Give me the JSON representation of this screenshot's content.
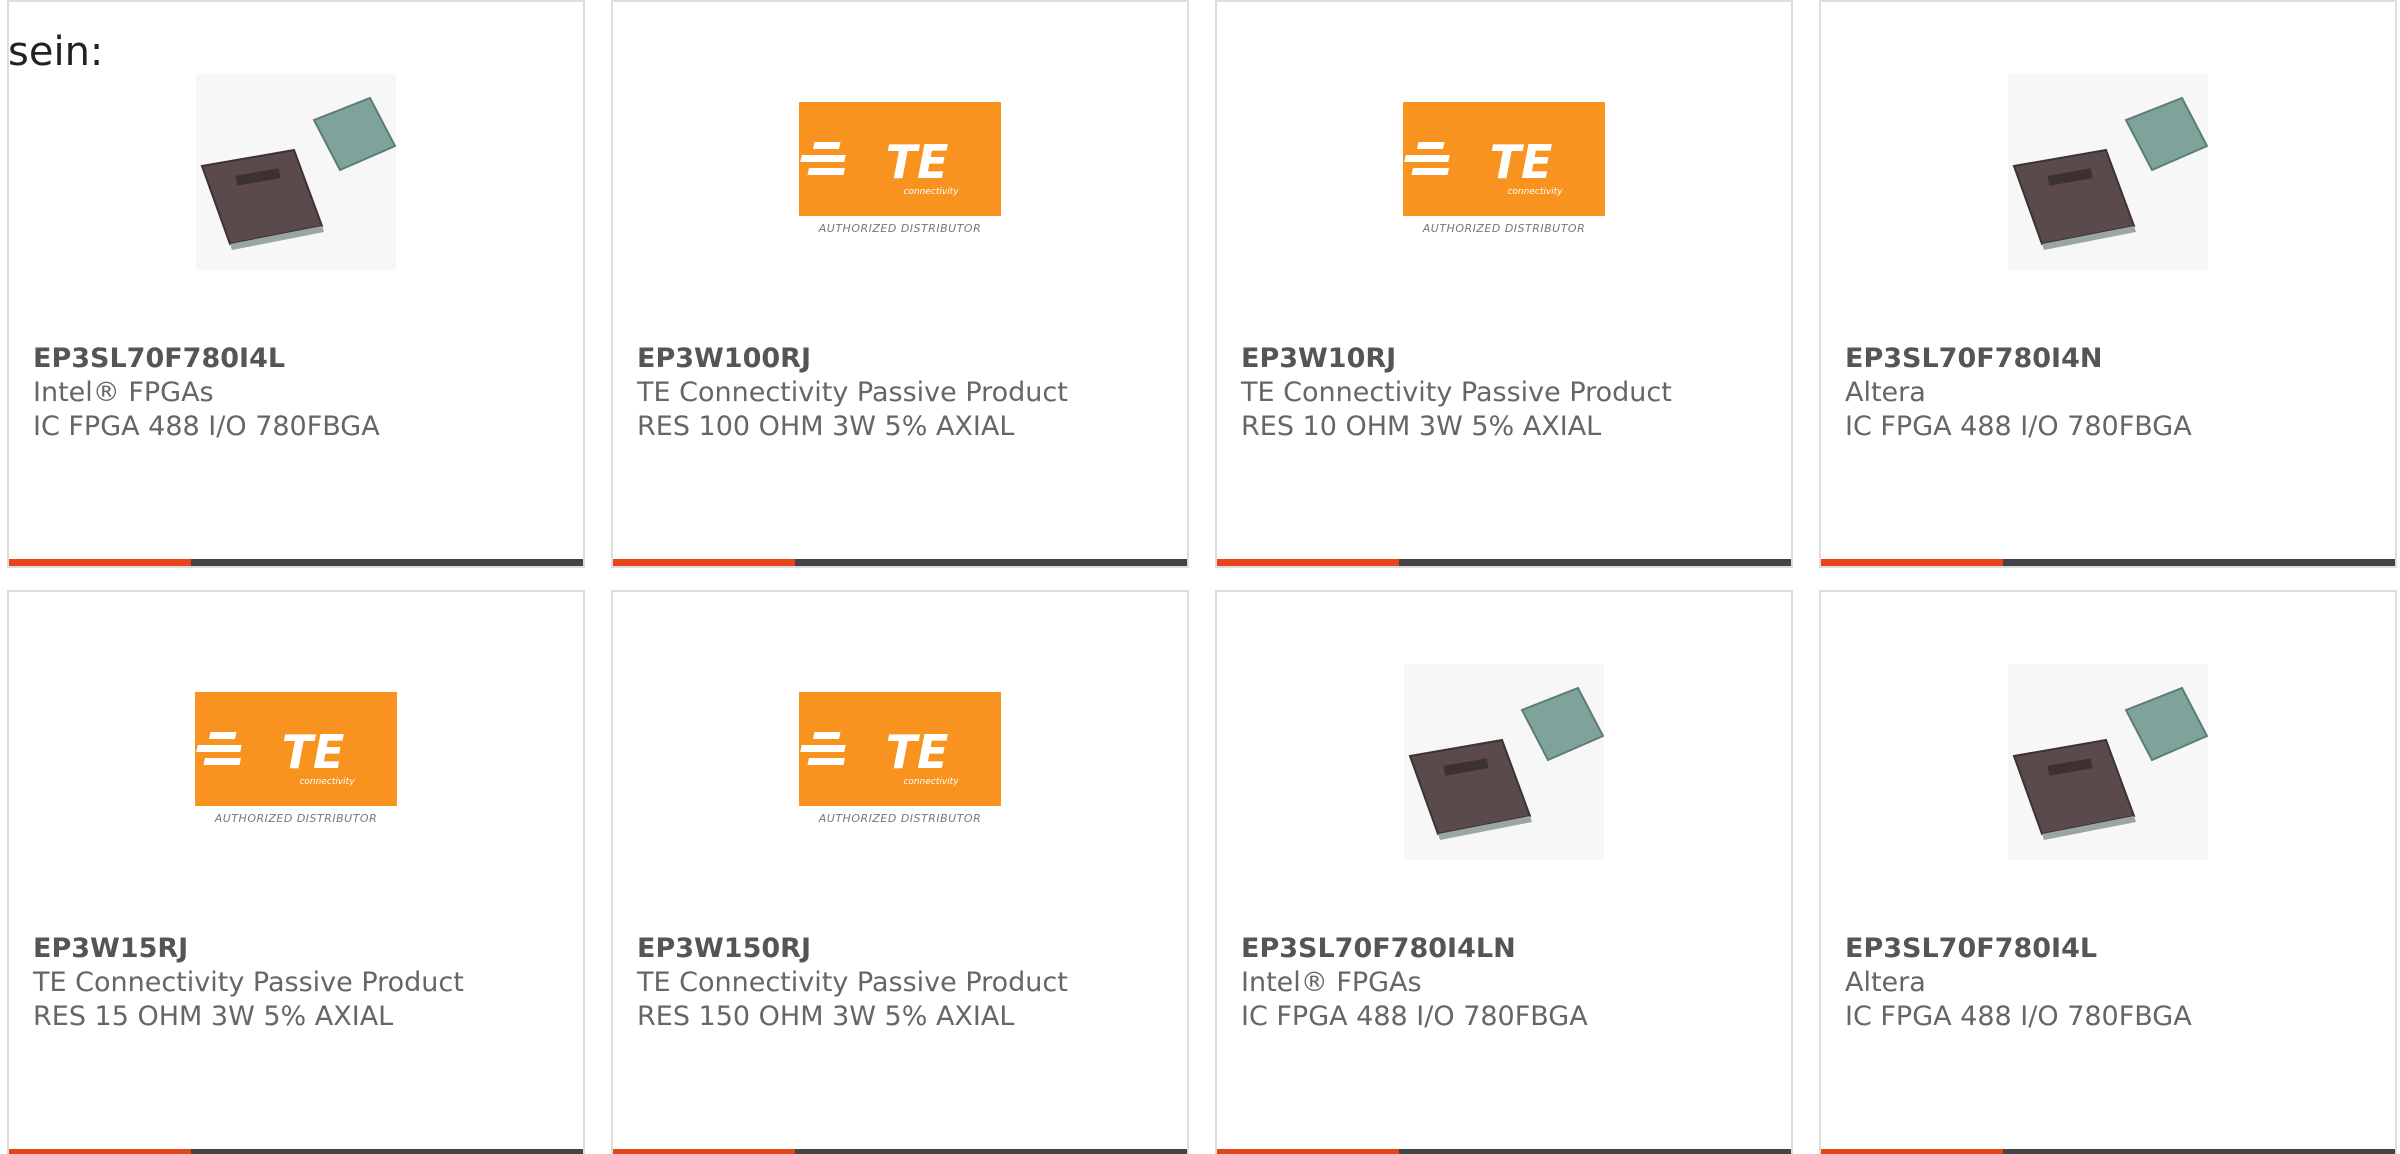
{
  "intro_text": "sein:",
  "colors": {
    "accent": "#e8441a",
    "bar": "#444444",
    "te_orange": "#f7931e",
    "border": "#dddddd"
  },
  "cards": [
    {
      "part_no": "EP3SL70F780I4L",
      "manufacturer": "Intel® FPGAs",
      "description": "IC FPGA 488 I/O 780FBGA",
      "image": "fpga-chip-image"
    },
    {
      "part_no": "EP3W100RJ",
      "manufacturer": "TE Connectivity Passive Product",
      "description": "RES 100 OHM 3W 5% AXIAL",
      "image": "te-connectivity-logo",
      "logo_text": "TE",
      "logo_subtext": "connectivity",
      "logo_caption": "AUTHORIZED DISTRIBUTOR"
    },
    {
      "part_no": "EP3W10RJ",
      "manufacturer": "TE Connectivity Passive Product",
      "description": "RES 10 OHM 3W 5% AXIAL",
      "image": "te-connectivity-logo",
      "logo_text": "TE",
      "logo_subtext": "connectivity",
      "logo_caption": "AUTHORIZED DISTRIBUTOR"
    },
    {
      "part_no": "EP3SL70F780I4N",
      "manufacturer": "Altera",
      "description": "IC FPGA 488 I/O 780FBGA",
      "image": "fpga-chip-image"
    },
    {
      "part_no": "EP3W15RJ",
      "manufacturer": "TE Connectivity Passive Product",
      "description": "RES 15 OHM 3W 5% AXIAL",
      "image": "te-connectivity-logo",
      "logo_text": "TE",
      "logo_subtext": "connectivity",
      "logo_caption": "AUTHORIZED DISTRIBUTOR"
    },
    {
      "part_no": "EP3W150RJ",
      "manufacturer": "TE Connectivity Passive Product",
      "description": "RES 150 OHM 3W 5% AXIAL",
      "image": "te-connectivity-logo",
      "logo_text": "TE",
      "logo_subtext": "connectivity",
      "logo_caption": "AUTHORIZED DISTRIBUTOR"
    },
    {
      "part_no": "EP3SL70F780I4LN",
      "manufacturer": "Intel® FPGAs",
      "description": "IC FPGA 488 I/O 780FBGA",
      "image": "fpga-chip-image"
    },
    {
      "part_no": "EP3SL70F780I4L",
      "manufacturer": "Altera",
      "description": "IC FPGA 488 I/O 780FBGA",
      "image": "fpga-chip-image"
    }
  ]
}
